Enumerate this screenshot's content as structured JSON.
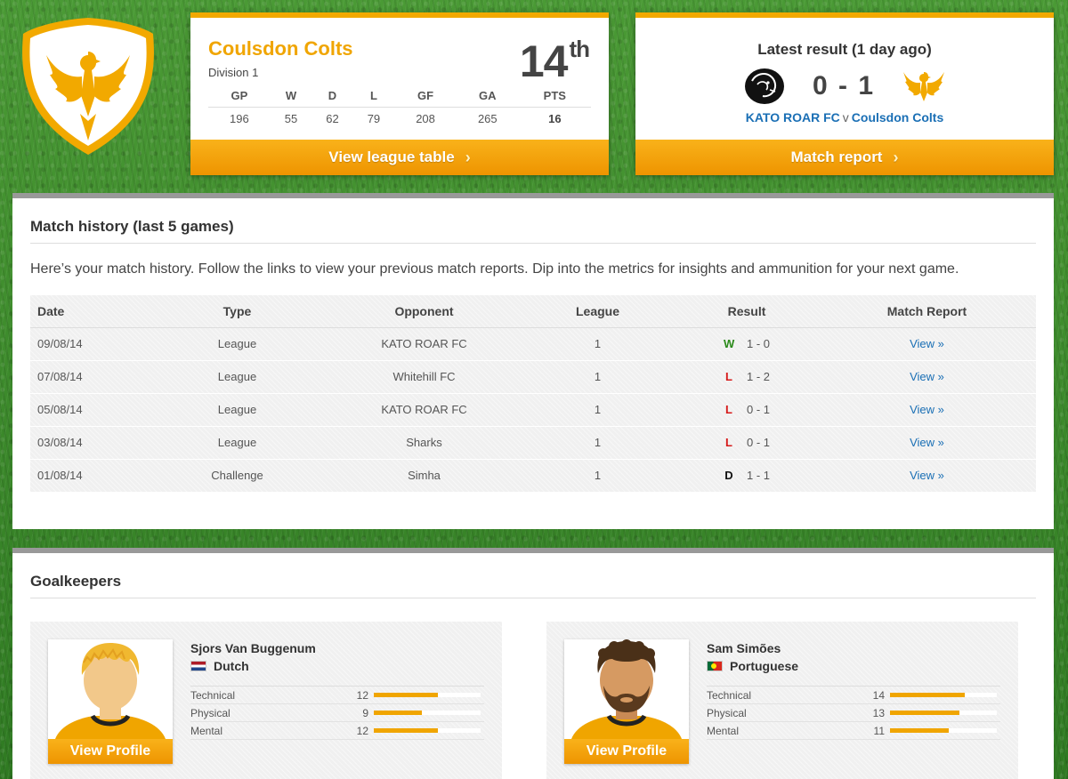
{
  "club": {
    "name": "Coulsdon Colts",
    "division": "Division 1",
    "position_number": "14",
    "position_suffix": "th",
    "stat_headers": [
      "GP",
      "W",
      "D",
      "L",
      "GF",
      "GA",
      "PTS"
    ],
    "stat_values": [
      "196",
      "55",
      "62",
      "79",
      "208",
      "265",
      "16"
    ],
    "league_table_label": "View league table",
    "chevron": "›"
  },
  "latest": {
    "title": "Latest result (1 day ago)",
    "score": "0 - 1",
    "home_team": "KATO ROAR FC",
    "vs": "v",
    "away_team": "Coulsdon Colts",
    "match_report_label": "Match report",
    "chevron": "›"
  },
  "history": {
    "title": "Match history (last 5 games)",
    "intro": "Here’s your match history. Follow the links to view your previous match reports. Dip into the metrics for insights and ammunition for your next game.",
    "columns": [
      "Date",
      "Type",
      "Opponent",
      "League",
      "Result",
      "Match Report"
    ],
    "rows": [
      {
        "date": "09/08/14",
        "type": "League",
        "opponent": "KATO ROAR FC",
        "league": "1",
        "outcome": "W",
        "score": "1 - 0",
        "link": "View »"
      },
      {
        "date": "07/08/14",
        "type": "League",
        "opponent": "Whitehill FC",
        "league": "1",
        "outcome": "L",
        "score": "1 - 2",
        "link": "View »"
      },
      {
        "date": "05/08/14",
        "type": "League",
        "opponent": "KATO ROAR FC",
        "league": "1",
        "outcome": "L",
        "score": "0 - 1",
        "link": "View »"
      },
      {
        "date": "03/08/14",
        "type": "League",
        "opponent": "Sharks",
        "league": "1",
        "outcome": "L",
        "score": "0 - 1",
        "link": "View »"
      },
      {
        "date": "01/08/14",
        "type": "Challenge",
        "opponent": "Simha",
        "league": "1",
        "outcome": "D",
        "score": "1 - 1",
        "link": "View »"
      }
    ]
  },
  "goalkeepers": {
    "title": "Goalkeepers",
    "players": [
      {
        "name": "Sjors Van Buggenum",
        "nationality": "Dutch",
        "profile_label": "View Profile",
        "attributes": [
          {
            "label": "Technical",
            "value": "12",
            "level": 0.6
          },
          {
            "label": "Physical",
            "value": "9",
            "level": 0.45
          },
          {
            "label": "Mental",
            "value": "12",
            "level": 0.6
          }
        ]
      },
      {
        "name": "Sam Simões",
        "nationality": "Portuguese",
        "profile_label": "View Profile",
        "attributes": [
          {
            "label": "Technical",
            "value": "14",
            "level": 0.7
          },
          {
            "label": "Physical",
            "value": "13",
            "level": 0.65
          },
          {
            "label": "Mental",
            "value": "11",
            "level": 0.55
          }
        ]
      }
    ]
  },
  "colors": {
    "accent": "#f2a900",
    "link": "#1a6fb5",
    "win": "#2a8a1a",
    "loss": "#d61a1a"
  }
}
